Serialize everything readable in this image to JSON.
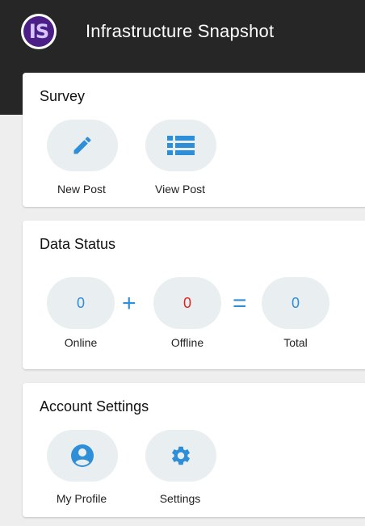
{
  "header": {
    "logo_text": "IS",
    "title": "Infrastructure Snapshot"
  },
  "survey": {
    "title": "Survey",
    "new_post_label": "New Post",
    "view_post_label": "View Post"
  },
  "data_status": {
    "title": "Data Status",
    "online_count": "0",
    "offline_count": "0",
    "total_count": "0",
    "plus_sign": "+",
    "equals_sign": "=",
    "online_label": "Online",
    "offline_label": "Offline",
    "total_label": "Total"
  },
  "account": {
    "title": "Account Settings",
    "profile_label": "My Profile",
    "settings_label": "Settings"
  },
  "icons": {
    "new_post": "pencil-icon",
    "view_post": "list-icon",
    "profile": "user-circle-icon",
    "settings": "gear-icon"
  },
  "colors": {
    "accent": "#2f8ed8",
    "offline": "#e02424",
    "header_bg": "#262626"
  }
}
